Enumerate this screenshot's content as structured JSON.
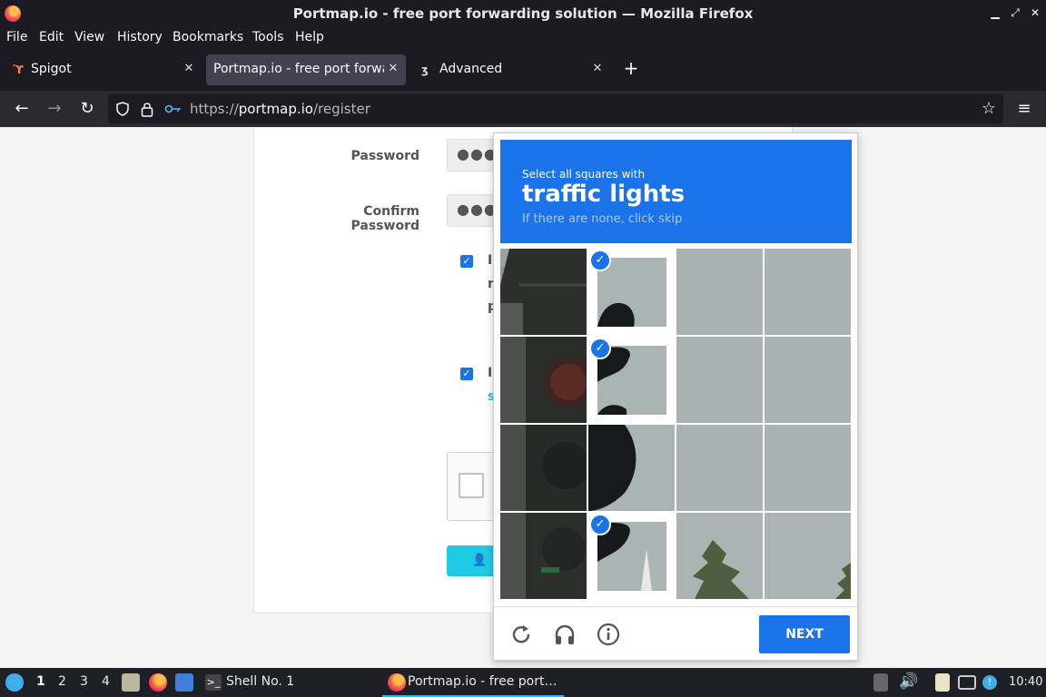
{
  "window": {
    "title": "Portmap.io - free port forwarding solution — Mozilla Firefox"
  },
  "menu": [
    "File",
    "Edit",
    "View",
    "History",
    "Bookmarks",
    "Tools",
    "Help"
  ],
  "tabs": [
    {
      "label": "Spigot",
      "active": false
    },
    {
      "label": "Portmap.io - free port forwar",
      "active": true
    },
    {
      "label": "Advanced",
      "active": false
    }
  ],
  "url": {
    "prefix": "https://",
    "host": "portmap.io",
    "path": "/register"
  },
  "form": {
    "password_label": "Password",
    "password_value": "●●●",
    "confirm_label": "Confirm Password",
    "confirm_value": "●●●",
    "agree1_fragment": "I",
    "agree1_line2": "r",
    "agree1_line3": "p",
    "agree2_fragment": "I",
    "agree2_line2": "s"
  },
  "captcha": {
    "instruction_small": "Select all squares with",
    "target": "traffic lights",
    "hint": "If there are none, click skip",
    "selected_tiles": [
      1,
      5,
      13
    ],
    "next_label": "NEXT",
    "icons": [
      "reload-icon",
      "audio-icon",
      "info-icon"
    ]
  },
  "taskbar": {
    "workspaces": [
      "1",
      "2",
      "3",
      "4"
    ],
    "active_workspace": "1",
    "shell_label": "Shell No. 1",
    "firefox_task": "Portmap.io - free port…",
    "clock": "10:40"
  },
  "colors": {
    "captcha_blue": "#1a73e8",
    "register_cyan": "#1fc8e3",
    "chrome_dark": "#1c1b22"
  }
}
